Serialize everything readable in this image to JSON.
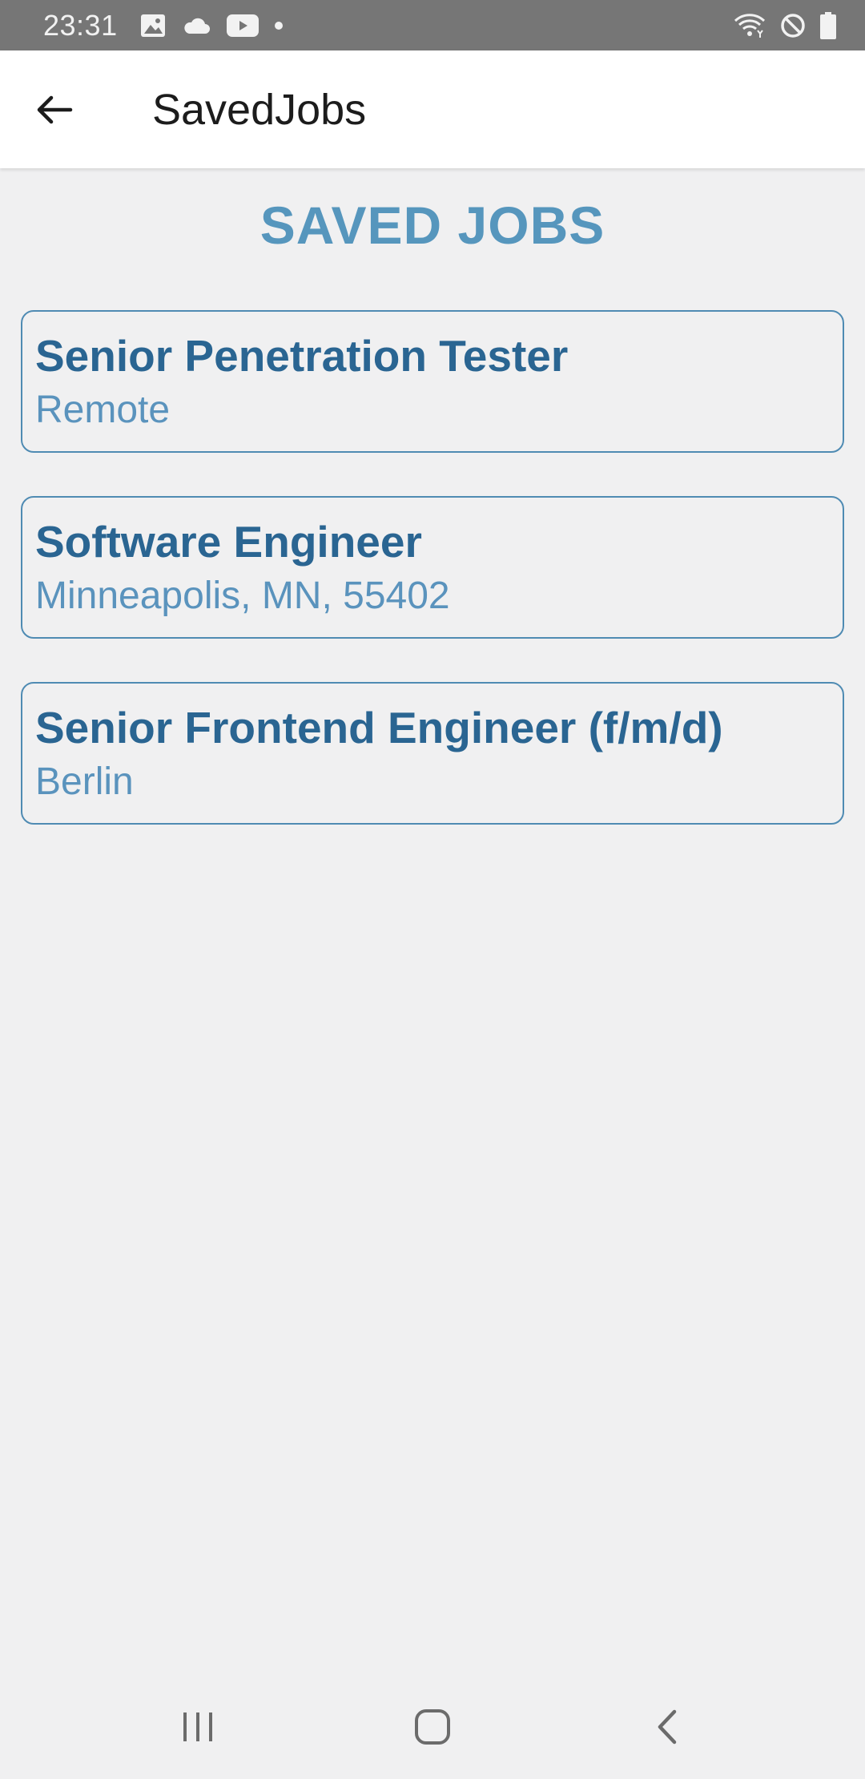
{
  "status_bar": {
    "time": "23:31",
    "left_icons": [
      "image-icon",
      "cloud-icon",
      "youtube-icon",
      "dot-icon"
    ],
    "right_icons": [
      "wifi-icon",
      "do-not-disturb-icon",
      "battery-icon"
    ]
  },
  "app_bar": {
    "back_icon": "arrow-left-icon",
    "title": "SavedJobs"
  },
  "main": {
    "heading": "SAVED JOBS",
    "jobs": [
      {
        "title": "Senior Penetration Tester",
        "location": "Remote"
      },
      {
        "title": "Software Engineer",
        "location": "Minneapolis, MN, 55402"
      },
      {
        "title": "Senior Frontend Engineer (f/m/d)",
        "location": "Berlin"
      }
    ]
  },
  "nav_bar": {
    "buttons": [
      "recent-apps-icon",
      "home-icon",
      "back-icon"
    ]
  },
  "colors": {
    "heading": "#5696bd",
    "job_title": "#2a6592",
    "job_location": "#5a93bd",
    "card_border": "#4f8bb3",
    "status_bar": "#767676",
    "background": "#f0f0f1"
  }
}
